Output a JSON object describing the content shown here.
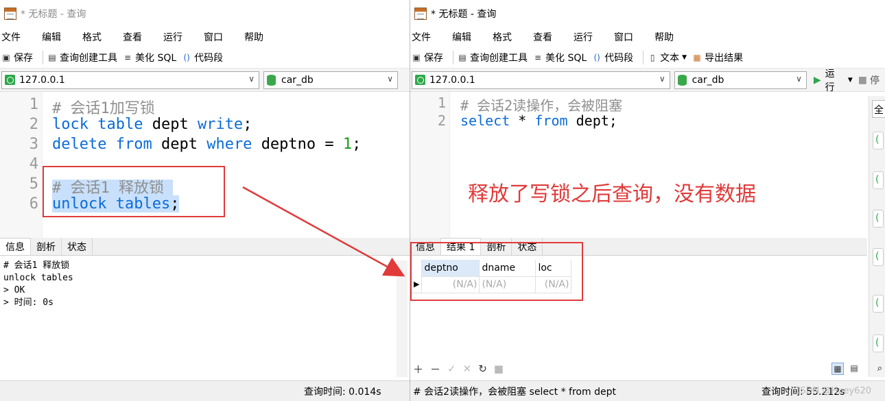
{
  "win1": {
    "title": "* 无标题 - 查询",
    "menu": [
      "文件",
      "编辑",
      "格式",
      "查看",
      "运行",
      "窗口",
      "帮助"
    ],
    "toolbar": {
      "save": "保存",
      "builder": "查询创建工具",
      "beautify": "美化 SQL",
      "snippet": "代码段"
    },
    "connection": "127.0.0.1",
    "database": "car_db",
    "line_numbers": [
      "1",
      "2",
      "3",
      "4",
      "5",
      "6"
    ],
    "code": {
      "l1": "# 会话1加写锁",
      "l2_kw1": "lock",
      "l2_kw2": "table",
      "l2_id": "dept",
      "l2_kw3": "write",
      "l2_end": ";",
      "l3_kw1": "delete",
      "l3_kw2": "from",
      "l3_id": "dept",
      "l3_kw3": "where",
      "l3_id2": "deptno",
      "l3_op": "=",
      "l3_num": "1",
      "l3_end": ";",
      "l5": "# 会话1 释放锁",
      "l6_kw1": "unlock",
      "l6_kw2": "tables",
      "l6_end": ";"
    },
    "tabs": [
      "信息",
      "剖析",
      "状态"
    ],
    "output": [
      "# 会话1 释放锁",
      "unlock tables",
      "> OK",
      "> 时间: 0s"
    ],
    "status_time": "查询时间: 0.014s"
  },
  "win2": {
    "title": "* 无标题 - 查询",
    "menu": [
      "文件",
      "编辑",
      "格式",
      "查看",
      "运行",
      "窗口",
      "帮助"
    ],
    "toolbar": {
      "save": "保存",
      "builder": "查询创建工具",
      "beautify": "美化 SQL",
      "snippet": "代码段",
      "text": "文本",
      "export": "导出结果"
    },
    "connection": "127.0.0.1",
    "database": "car_db",
    "run": "运行",
    "stop": "停",
    "line_numbers": [
      "1",
      "2"
    ],
    "code": {
      "l1": "# 会话2读操作，会被阻塞",
      "l2_kw1": "select",
      "l2_star": "*",
      "l2_kw2": "from",
      "l2_id": "dept",
      "l2_end": ";"
    },
    "annotation": "释放了写锁之后查询，没有数据",
    "tabs": [
      "信息",
      "结果 1",
      "剖析",
      "状态"
    ],
    "columns": [
      "deptno",
      "dname",
      "loc"
    ],
    "row": [
      "(N/A)",
      "(N/A)",
      "(N/A)"
    ],
    "side_label": "全",
    "status_sql": "# 会话2读操作，会被阻塞 select * from dept",
    "status_time": "查询时间: 55.212s",
    "watermark": "CSDN @Huey620"
  },
  "colors": {
    "keyword": "#0b6bd8",
    "comment": "#8f8f8f",
    "number": "#1a9b1a",
    "annotation_red": "#e03a3a",
    "selection": "#c8e0fb"
  }
}
